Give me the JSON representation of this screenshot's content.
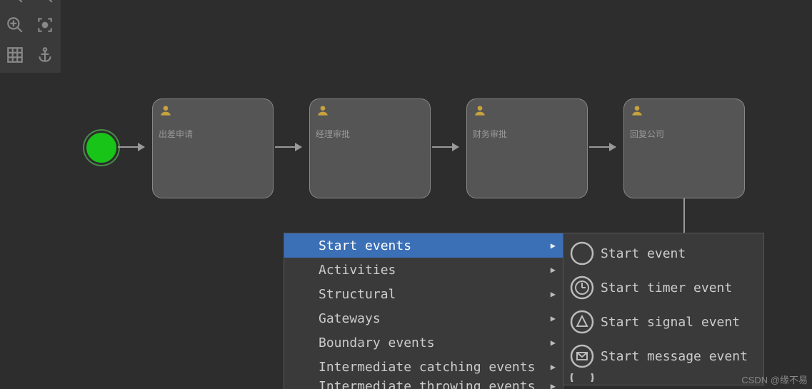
{
  "toolbar": {
    "zoom_out": "zoom-out",
    "zoom_in": "zoom-in",
    "zoom_fit": "zoom-fit",
    "select": "select",
    "grid": "grid",
    "anchor": "anchor"
  },
  "canvas": {
    "start_event": "start",
    "tasks": [
      {
        "label": "出差申请"
      },
      {
        "label": "经理审批"
      },
      {
        "label": "财务审批"
      },
      {
        "label": "回复公司"
      }
    ]
  },
  "menu": {
    "items": [
      {
        "label": "Start events",
        "selected": true
      },
      {
        "label": "Activities",
        "selected": false
      },
      {
        "label": "Structural",
        "selected": false
      },
      {
        "label": "Gateways",
        "selected": false
      },
      {
        "label": "Boundary events",
        "selected": false
      },
      {
        "label": "Intermediate catching events",
        "selected": false
      },
      {
        "label": "Intermediate throwing events",
        "selected": false
      }
    ]
  },
  "submenu": {
    "items": [
      {
        "label": "Start event",
        "icon": "circle"
      },
      {
        "label": "Start timer event",
        "icon": "timer"
      },
      {
        "label": "Start signal event",
        "icon": "signal"
      },
      {
        "label": "Start message event",
        "icon": "message"
      }
    ]
  },
  "watermark": "CSDN @缘不易"
}
